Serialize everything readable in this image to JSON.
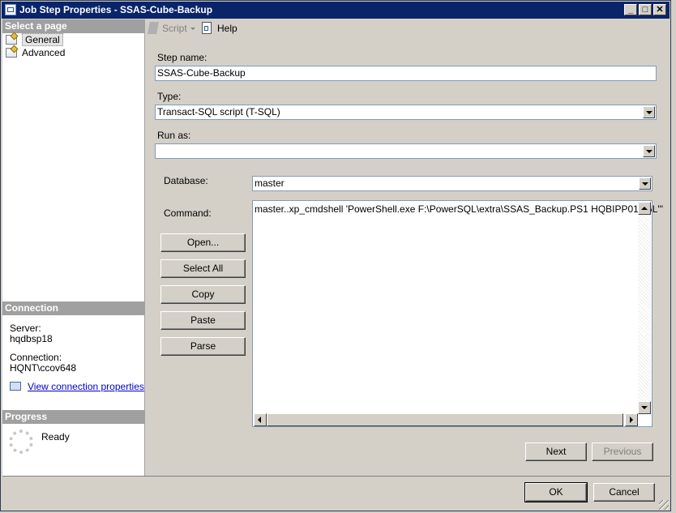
{
  "window": {
    "title": "Job Step Properties - SSAS-Cube-Backup"
  },
  "title_buttons": {
    "minimize": "_",
    "maximize": "□",
    "close": "✕"
  },
  "left_pane": {
    "select_page_header": "Select a page",
    "pages": [
      {
        "label": "General",
        "selected": true,
        "icon": "page-icon"
      },
      {
        "label": "Advanced",
        "selected": false,
        "icon": "page-icon"
      }
    ],
    "connection": {
      "header": "Connection",
      "server_label": "Server:",
      "server_value": "hqdbsp18",
      "connection_label": "Connection:",
      "connection_value": "HQNT\\ccov648",
      "view_link": "View connection properties"
    },
    "progress": {
      "header": "Progress",
      "status": "Ready"
    }
  },
  "toolbar": {
    "script_label": "Script",
    "help_label": "Help"
  },
  "form": {
    "step_name_label": "Step name:",
    "step_name_value": "SSAS-Cube-Backup",
    "type_label": "Type:",
    "type_value": "Transact-SQL script (T-SQL)",
    "run_as_label": "Run as:",
    "run_as_value": "",
    "database_label": "Database:",
    "database_value": "master",
    "command_label": "Command:",
    "command_value": "master..xp_cmdshell 'PowerShell.exe F:\\PowerSQL\\extra\\SSAS_Backup.PS1 HQBIPP01 \"GL\"'"
  },
  "command_buttons": {
    "open": "Open...",
    "select_all": "Select All",
    "copy": "Copy",
    "paste": "Paste",
    "parse": "Parse"
  },
  "nav_buttons": {
    "next": "Next",
    "previous": "Previous"
  },
  "dialog_buttons": {
    "ok": "OK",
    "cancel": "Cancel"
  },
  "colors": {
    "titlebar": "#0a246a",
    "section_header": "#a0a0a0",
    "link": "#0000cc",
    "dialog_bg": "#d4d0c8"
  }
}
